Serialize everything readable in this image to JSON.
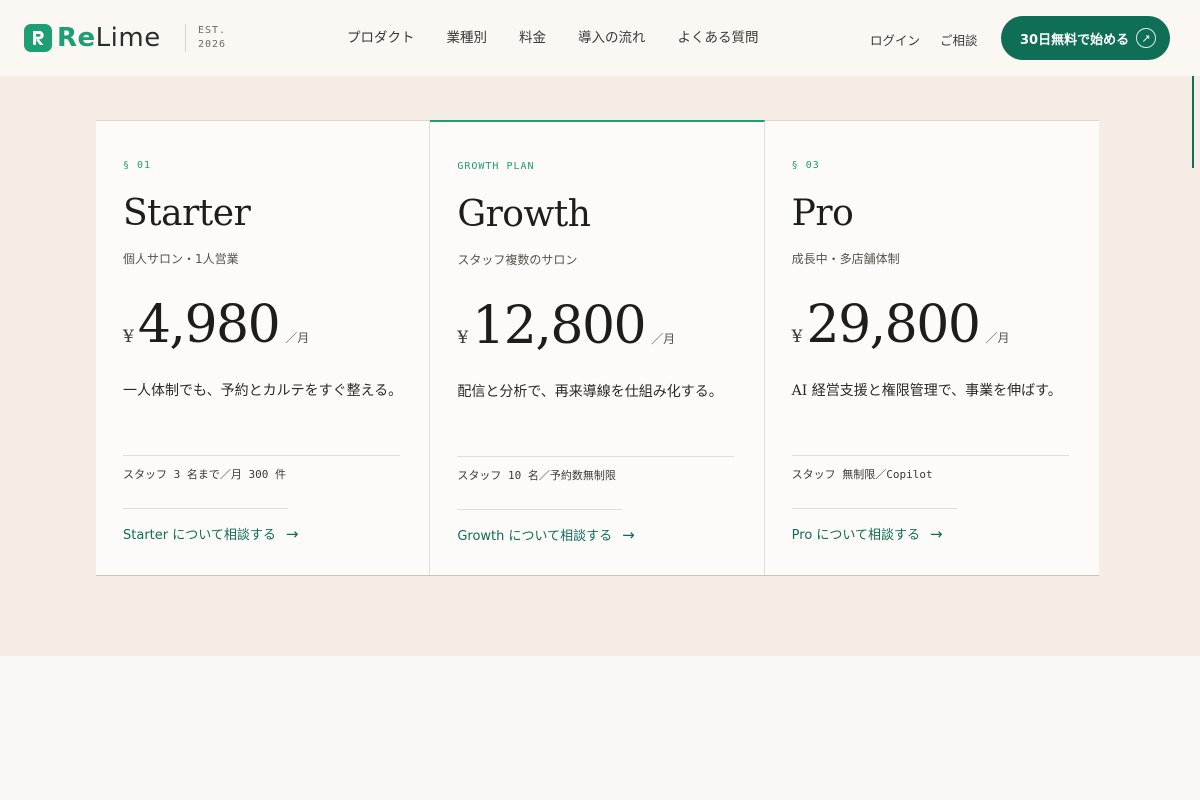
{
  "brand": {
    "name_prefix": "Re",
    "name_suffix": "Lime",
    "est_label": "EST.",
    "est_year": "2026",
    "accent": "#1d9e75",
    "dark_accent": "#0f6e56"
  },
  "nav": {
    "items": [
      "プロダクト",
      "業種別",
      "料金",
      "導入の流れ",
      "よくある質問"
    ]
  },
  "header_actions": {
    "login": "ログイン",
    "consult": "ご相談",
    "cta_label": "30日無料で始める",
    "cta_icon": "arrow-up-right-icon"
  },
  "plans": [
    {
      "tag": "§ 01",
      "name": "Starter",
      "subtitle": "個人サロン・1人営業",
      "currency": "¥",
      "price": "4,980",
      "per": "／月",
      "description": "一人体制でも、予約とカルテをすぐ整える。",
      "limits": "スタッフ 3 名まで／月 300 件",
      "link": "Starter について相談する",
      "link_arrow": "→",
      "featured": false
    },
    {
      "tag": "GROWTH PLAN",
      "name": "Growth",
      "subtitle": "スタッフ複数のサロン",
      "currency": "¥",
      "price": "12,800",
      "per": "／月",
      "description": "配信と分析で、再来導線を仕組み化する。",
      "limits": "スタッフ 10 名／予約数無制限",
      "link": "Growth について相談する",
      "link_arrow": "→",
      "featured": true
    },
    {
      "tag": "§ 03",
      "name": "Pro",
      "subtitle": "成長中・多店舗体制",
      "currency": "¥",
      "price": "29,800",
      "per": "／月",
      "description": "AI 経営支援と権限管理で、事業を伸ばす。",
      "limits": "スタッフ 無制限／Copilot",
      "link": "Pro について相談する",
      "link_arrow": "→",
      "featured": false
    }
  ]
}
